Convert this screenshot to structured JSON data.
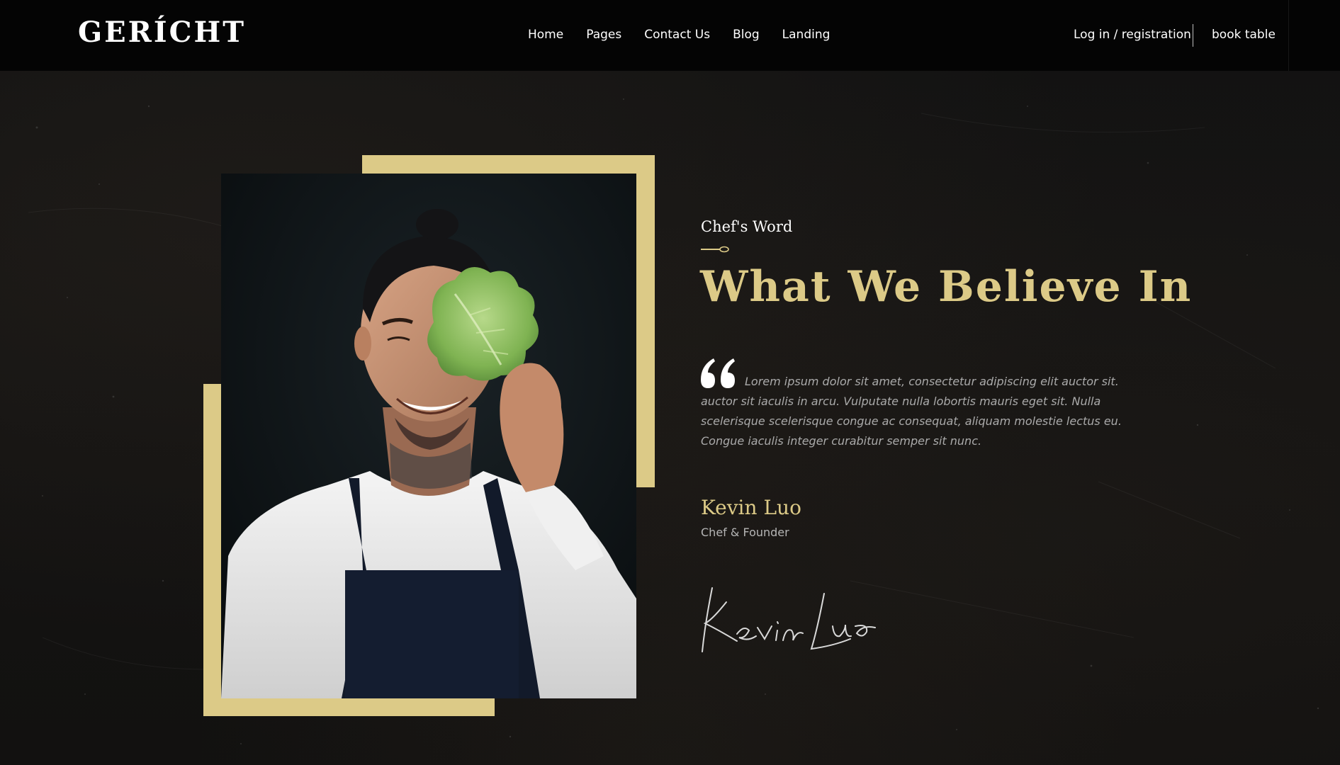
{
  "nav": {
    "logo": "GERÍCHT",
    "links": [
      "Home",
      "Pages",
      "Contact Us",
      "Blog",
      "Landing"
    ],
    "login": "Log in / registration",
    "book": "book table"
  },
  "section": {
    "subtitle": "Chef's Word",
    "headline": "What We Believe In",
    "quote": "Lorem ipsum dolor sit amet, consectetur adipiscing elit auctor sit. auctor sit iaculis in arcu. Vulputate nulla lobortis mauris eget sit. Nulla scelerisque scelerisque congue ac consequat, aliquam molestie lectus eu. Congue iaculis integer curabitur semper sit nunc.",
    "chef_name": "Kevin Luo",
    "chef_role": "Chef & Founder",
    "signature": "Kevin Luo"
  },
  "colors": {
    "accent": "#dcca87",
    "background": "#0c0c0c",
    "navbar": "#040404"
  }
}
